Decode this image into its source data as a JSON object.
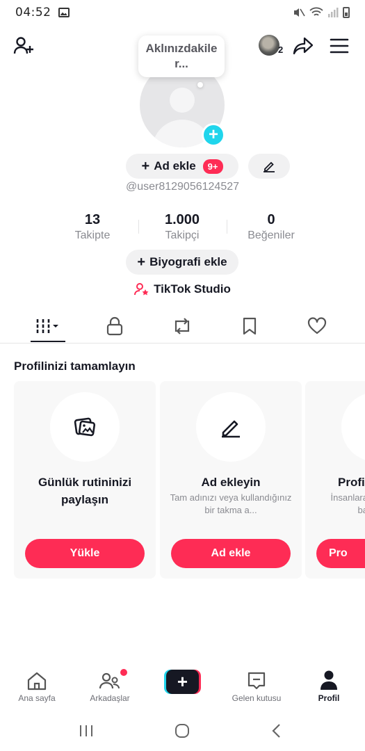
{
  "status": {
    "time": "04:52"
  },
  "header": {
    "bubble_text": "Aklınızdakile r...",
    "friend_count": "2"
  },
  "profile": {
    "add_name_label": "Ad ekle",
    "badge": "9+",
    "username": "@user8129056124527",
    "bio_label": "Biyografi ekle",
    "studio_label": "TikTok Studio"
  },
  "stats": [
    {
      "value": "13",
      "label": "Takipte"
    },
    {
      "value": "1.000",
      "label": "Takipçi"
    },
    {
      "value": "0",
      "label": "Beğeniler"
    }
  ],
  "tabs": [
    "videos-grid-icon",
    "lock-icon",
    "repost-icon",
    "bookmark-icon",
    "heart-icon"
  ],
  "section": {
    "title": "Profilinizi tamamlayın"
  },
  "cards": [
    {
      "title": "Günlük rutininizi paylaşın",
      "desc": "",
      "button": "Yükle",
      "icon": "photo-upload-icon"
    },
    {
      "title": "Ad ekleyin",
      "desc": "Tam adınızı veya kullandığınız bir takma a...",
      "button": "Ad ekle",
      "icon": "pencil-icon"
    },
    {
      "title": "Profi",
      "desc": "İnsanlara ba",
      "button": "Pro",
      "icon": ""
    }
  ],
  "nav": {
    "home": "Ana sayfa",
    "friends": "Arkadaşlar",
    "inbox": "Gelen kutusu",
    "profile": "Profil"
  },
  "colors": {
    "accent": "#fe2c55",
    "cyan": "#20d5ec",
    "text": "#161823",
    "muted": "#8a8b91"
  }
}
